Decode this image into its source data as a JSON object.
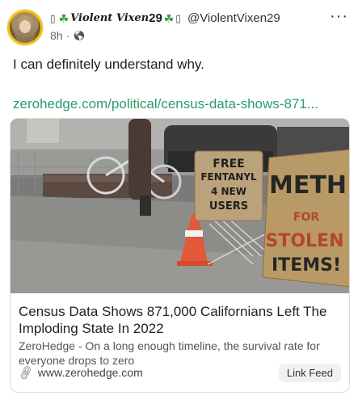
{
  "post": {
    "name_prefix_glyph": "▯",
    "name_text": "Violent Vixen",
    "name_number": "29",
    "name_suffix_glyph": "▯",
    "handle": "@ViolentVixen29",
    "time": "8h",
    "text": "I can definitely understand why.",
    "link": "zerohedge.com/political/census-data-shows-871..."
  },
  "card": {
    "title": "Census Data Shows 871,000 Californians Left The Imploding State In 2022",
    "description": "ZeroHedge - On a long enough timeline, the survival rate for everyone drops to zero",
    "domain": "www.zerohedge.com",
    "link_feed_label": "Link Feed",
    "sign1": [
      "FREE",
      "FENTANYL",
      "4 NEW",
      "USERS"
    ],
    "sign2": [
      "METH",
      "FOR",
      "STOLEN",
      "ITEMS!"
    ]
  },
  "colors": {
    "link": "#2a9d6a",
    "avatar_ring": "#f2c200",
    "clover": "#2e9b3a"
  },
  "icons": {
    "more": "more-options-icon",
    "globe": "globe-icon",
    "link": "link-icon"
  }
}
